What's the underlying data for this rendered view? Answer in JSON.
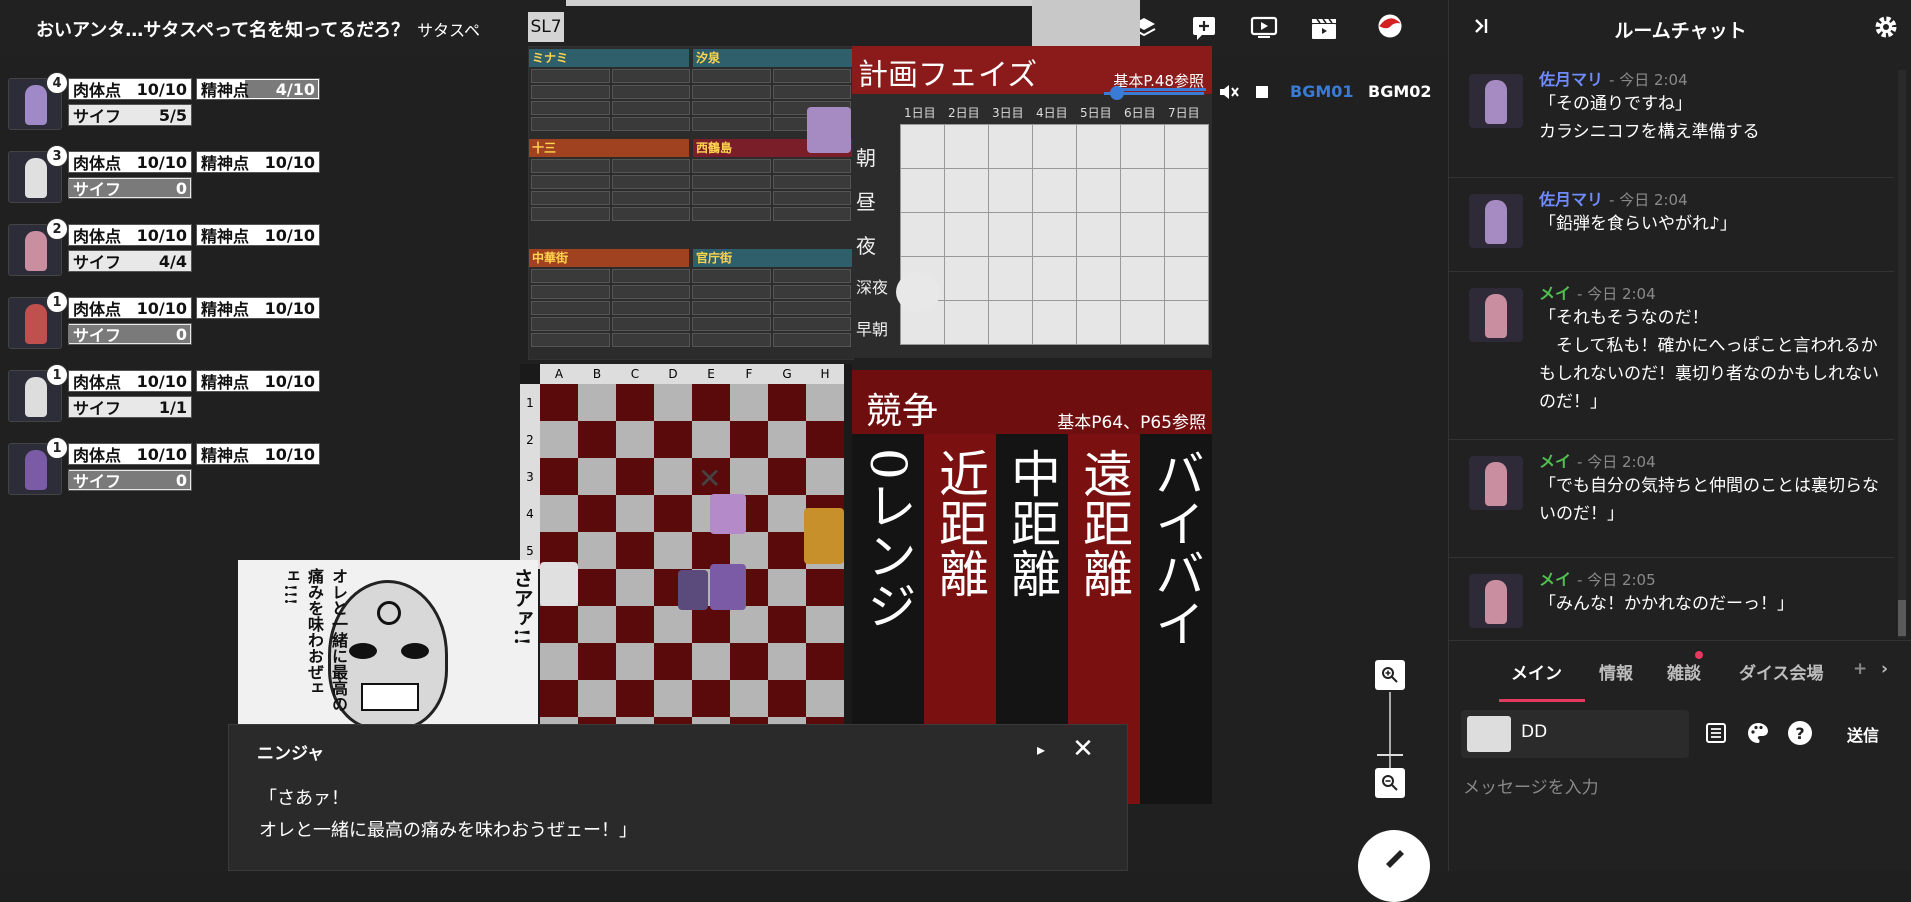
{
  "room": {
    "title": "おいアンタ…サタスペって名を知ってるだろ？",
    "subtitle": "サタスペ"
  },
  "top_icons": [
    "face-icon",
    "layers-icon",
    "add-message-icon",
    "screen-icon",
    "clapperboard-icon",
    "logo-icon"
  ],
  "characters": [
    {
      "count": "4",
      "hp_label": "肉体点",
      "hp": "10/10",
      "mp_label": "精神点",
      "mp": "4/10",
      "mp_fill": 0.6,
      "wallet_label": "サイフ",
      "wallet": "5/5",
      "wallet_fill": 0.0,
      "avatar_color": "#9f8ac7"
    },
    {
      "count": "3",
      "hp_label": "肉体点",
      "hp": "10/10",
      "mp_label": "精神点",
      "mp": "10/10",
      "mp_fill": 0.0,
      "wallet_label": "サイフ",
      "wallet": "0",
      "wallet_fill": 1.0,
      "avatar_color": "#e0e0e0"
    },
    {
      "count": "2",
      "hp_label": "肉体点",
      "hp": "10/10",
      "mp_label": "精神点",
      "mp": "10/10",
      "mp_fill": 0.0,
      "wallet_label": "サイフ",
      "wallet": "4/4",
      "wallet_fill": 0.0,
      "avatar_color": "#c98fa0"
    },
    {
      "count": "1",
      "hp_label": "肉体点",
      "hp": "10/10",
      "mp_label": "精神点",
      "mp": "10/10",
      "mp_fill": 0.0,
      "wallet_label": "サイフ",
      "wallet": "0",
      "wallet_fill": 1.0,
      "avatar_color": "#c0504d"
    },
    {
      "count": "1",
      "hp_label": "肉体点",
      "hp": "10/10",
      "mp_label": "精神点",
      "mp": "10/10",
      "mp_fill": 0.0,
      "wallet_label": "サイフ",
      "wallet": "1/1",
      "wallet_fill": 0.0,
      "avatar_color": "#dddddd"
    },
    {
      "count": "1",
      "hp_label": "肉体点",
      "hp": "10/10",
      "mp_label": "精神点",
      "mp": "10/10",
      "mp_fill": 0.0,
      "wallet_label": "サイフ",
      "wallet": "0",
      "wallet_fill": 1.0,
      "avatar_color": "#7b5aa6"
    }
  ],
  "sl_label": "SL7",
  "map_sections": [
    "ミナミ",
    "汐泉",
    "十三",
    "西鶴島",
    "中華街",
    "官庁街"
  ],
  "plan": {
    "title": "計画フェイズ",
    "ref": "基本P.48参照",
    "days": [
      "1日目",
      "2日目",
      "3日目",
      "4日目",
      "5日目",
      "6日目",
      "7日目"
    ],
    "periods": [
      "朝",
      "昼",
      "夜",
      "深夜",
      "早朝"
    ]
  },
  "board": {
    "cols": [
      "A",
      "B",
      "C",
      "D",
      "E",
      "F",
      "G",
      "H"
    ],
    "rows": [
      "1",
      "2",
      "3",
      "4",
      "5"
    ]
  },
  "competition": {
    "title": "競争",
    "ref": "基本P64、P65参照",
    "columns": [
      "0レンジ",
      "近距離",
      "中距離",
      "遠距離",
      "バイバイ"
    ]
  },
  "manga": {
    "shout": "さアァ!!",
    "line": "オレと一緒に最高の痛みを味わおぜェェ!!!"
  },
  "bgm": {
    "tracks": [
      "BGM01",
      "BGM02"
    ],
    "accent": "#3a7bd5"
  },
  "dialog": {
    "name": "ニンジャ",
    "text": "「さあァ！\nオレと一緒に最高の痛みを味わおうぜェー！」"
  },
  "chat": {
    "title": "ルームチャット",
    "messages": [
      {
        "name": "佐月マリ",
        "time": "- 今日 2:04",
        "text": "「その通りですね」\nカラシニコフを構え準備する",
        "color": "#6e8bff",
        "avatar": "#a68ac2"
      },
      {
        "name": "佐月マリ",
        "time": "- 今日 2:04",
        "text": "「鉛弾を食らいやがれ♪」",
        "color": "#6e8bff",
        "avatar": "#a68ac2"
      },
      {
        "name": "メイ",
        "time": "- 今日 2:04",
        "text": "「それもそうなのだ！\n　そして私も！確かにへっぽこと言われるかもしれないのだ！裏切り者なのかもしれないのだ！」",
        "color": "#4fc04f",
        "avatar": "#c98fa0"
      },
      {
        "name": "メイ",
        "time": "- 今日 2:04",
        "text": "「でも自分の気持ちと仲間のことは裏切らないのだ！」",
        "color": "#4fc04f",
        "avatar": "#c98fa0"
      },
      {
        "name": "メイ",
        "time": "- 今日 2:05",
        "text": "「みんな！かかれなのだーっ！」",
        "color": "#4fc04f",
        "avatar": "#c98fa0"
      }
    ],
    "tabs": [
      "メイン",
      "情報",
      "雑談",
      "ダイス会場"
    ],
    "tab_add": "+",
    "sender": "DD",
    "send_label": "送信",
    "input_placeholder": "メッセージを入力"
  },
  "accent_colors": {
    "tab_underline": "#e53960",
    "red_panel": "#8b1a1a"
  }
}
